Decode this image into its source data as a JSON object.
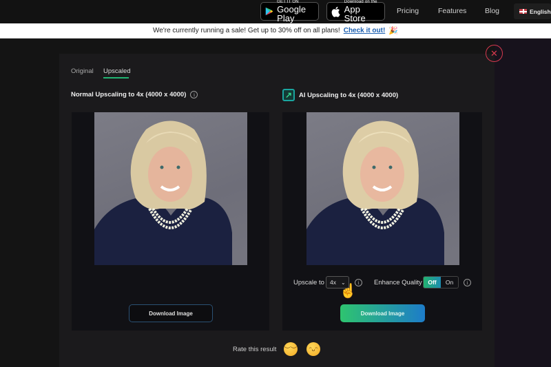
{
  "topnav": {
    "google_play": {
      "small": "GET IT ON",
      "big": "Google Play",
      "icon": "google-play-icon"
    },
    "app_store": {
      "small": "Download on the",
      "big": "App Store",
      "icon": "apple-icon"
    },
    "links": [
      "Pricing",
      "Features",
      "Blog"
    ],
    "language": {
      "label": "English",
      "icon": "uk-flag-icon"
    }
  },
  "banner": {
    "text": "We're currently running a sale! Get up to 30% off on all plans!",
    "link_label": "Check it out!",
    "icon": "party-popper-icon"
  },
  "modal": {
    "close_icon": "close-icon",
    "tabs": [
      {
        "label": "Original",
        "active": false
      },
      {
        "label": "Upscaled",
        "active": true
      }
    ],
    "left": {
      "title": "Normal Upscaling to 4x (4000 x 4000)",
      "download_label": "Download Image"
    },
    "right": {
      "title": "AI Upscaling to 4x (4000 x 4000)",
      "download_label": "Download Image",
      "upscale_label": "Upscale to",
      "upscale_value": "4x",
      "enhance_label": "Enhance Quality",
      "enhance_options": [
        "Off",
        "On"
      ],
      "enhance_selected": "Off"
    },
    "rating": {
      "label": "Rate this result",
      "options": [
        "disappointed-face",
        "grinning-face"
      ]
    }
  },
  "colors": {
    "accent_green": "#22b573",
    "accent_blue": "#1d7cc9",
    "close_red": "#d8394f",
    "link_blue": "#1b5fb0"
  }
}
